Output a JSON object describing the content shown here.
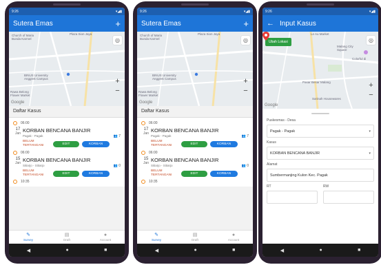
{
  "list_screen": {
    "status_time": "9:26",
    "status_icons": "▾◢▮",
    "app_title": "Sutera Emas",
    "add_label": "+",
    "map_labels": {
      "church": "Church of Maria Bunda Karmel",
      "plaza": "Plaza Sion Jaya",
      "campus": "BINUS University Anggrek Campus",
      "flower": "Rawa Belong Flower Market",
      "google": "Google"
    },
    "section_title": "Daftar Kasus",
    "cases": [
      {
        "time": "06:00",
        "day": "17",
        "month": "Jan",
        "title": "KORBAN BENCANA BANJIR",
        "location": "Pagak - Pagak",
        "count": "7",
        "status_line1": "BELUM",
        "status_line2": "TERTANGANI",
        "edit_label": "EDIT",
        "korban_label": "KORBAN"
      },
      {
        "time": "06:00",
        "day": "15",
        "month": "Jan",
        "title": "KORBAN BENCANA BANJIR",
        "location": "Sitiarjo - Sitiarjo",
        "count": "0",
        "status_line1": "BELUM",
        "status_line2": "TERTANGANI",
        "edit_label": "EDIT",
        "korban_label": "KORBAN"
      }
    ],
    "next_time": "10:35",
    "nav": [
      {
        "label": "Survey",
        "icon": "survey-icon"
      },
      {
        "label": "Draft",
        "icon": "draft-icon"
      },
      {
        "label": "Account",
        "icon": "account-icon"
      }
    ]
  },
  "form_screen": {
    "status_time": "9:26",
    "app_title": "Input Kasus",
    "back_label": "←",
    "ubah_lokasi": "Ubah Lokasi",
    "map_labels": {
      "top": "Le Au Market",
      "malang": "Malang City Square",
      "pasar": "Pasar Besar Malang",
      "sarinah": "Sarinah Housewares",
      "colorful": "Colorful di",
      "google": "Google"
    },
    "fields": {
      "puskesmas_label": "Puskesmas - Desa",
      "puskesmas_value": "Pagak - Pagak",
      "kasus_label": "Kasus",
      "kasus_value": "KORBAN BENCANA BANJIR",
      "alamat_label": "Alamat",
      "alamat_value": "Sumbermanjing Kulon Kec. Pagak",
      "rt_label": "RT",
      "rw_label": "RW"
    }
  },
  "colors": {
    "primary": "#1e75d8",
    "success": "#2e9e42",
    "warning": "#f08a1c",
    "danger": "#c44a26"
  }
}
